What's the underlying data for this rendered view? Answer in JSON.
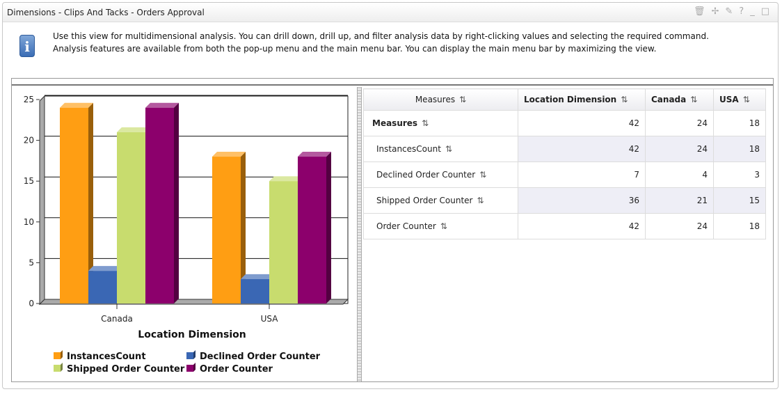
{
  "window": {
    "title": "Dimensions - Clips And Tacks - Orders Approval",
    "tools": [
      "trash-icon",
      "pin-icon",
      "edit-icon",
      "help-icon",
      "minimize-icon",
      "maximize-icon"
    ]
  },
  "info": {
    "text": "Use this view for multidimensional analysis. You can drill down, drill up, and filter analysis data by right-clicking values and selecting the required command. Analysis features are available from both the pop-up menu and the main menu bar. You can display the main menu bar by maximizing the view."
  },
  "chart_data": {
    "type": "bar",
    "categories": [
      "Canada",
      "USA"
    ],
    "xlabel": "Location Dimension",
    "ylabel": "",
    "ylim": [
      0,
      25
    ],
    "yticks": [
      0,
      5,
      10,
      15,
      20,
      25
    ],
    "grid": true,
    "legend": "bottom",
    "series": [
      {
        "name": "InstancesCount",
        "values": [
          24,
          18
        ],
        "color": "#ff9e13"
      },
      {
        "name": "Declined Order Counter",
        "values": [
          4,
          3
        ],
        "color": "#3a67b4"
      },
      {
        "name": "Shipped Order Counter",
        "values": [
          21,
          15
        ],
        "color": "#c8dc6e"
      },
      {
        "name": "Order Counter",
        "values": [
          24,
          18
        ],
        "color": "#8c006c"
      }
    ]
  },
  "table": {
    "headers": [
      "Measures",
      "Location Dimension",
      "Canada",
      "USA"
    ],
    "sort_glyph": "⇅",
    "rows": [
      {
        "label": "Measures",
        "values": [
          "42",
          "24",
          "18"
        ]
      },
      {
        "label": "InstancesCount",
        "values": [
          "42",
          "24",
          "18"
        ]
      },
      {
        "label": "Declined Order Counter",
        "values": [
          "7",
          "4",
          "3"
        ]
      },
      {
        "label": "Shipped Order Counter",
        "values": [
          "36",
          "21",
          "15"
        ]
      },
      {
        "label": "Order Counter",
        "values": [
          "42",
          "24",
          "18"
        ]
      }
    ]
  }
}
